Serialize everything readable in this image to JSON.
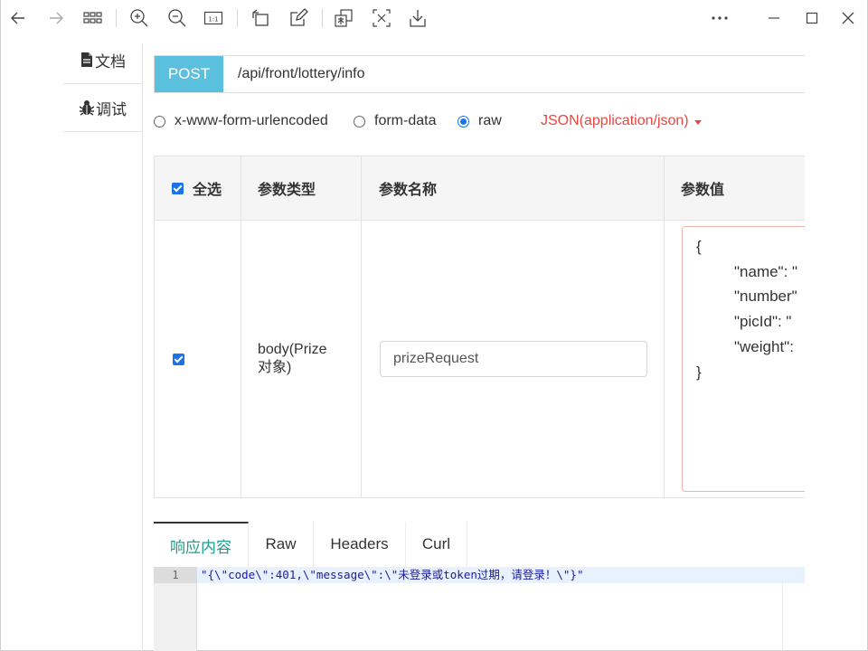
{
  "toolbar": {
    "buttons": [
      {
        "icon": "back-arrow-icon"
      },
      {
        "icon": "forward-arrow-icon"
      },
      {
        "icon": "grid-icon"
      },
      {
        "icon": "zoom-in-icon"
      },
      {
        "icon": "zoom-out-icon"
      },
      {
        "icon": "actual-size-icon"
      },
      {
        "icon": "rotate-icon"
      },
      {
        "icon": "edit-icon"
      },
      {
        "icon": "translate-icon"
      },
      {
        "icon": "ocr-icon"
      },
      {
        "icon": "download-icon"
      },
      {
        "icon": "more-icon"
      },
      {
        "icon": "minimize-icon"
      },
      {
        "icon": "maximize-icon"
      },
      {
        "icon": "close-icon"
      }
    ]
  },
  "nav": {
    "doc_label": "文档",
    "debug_label": "调试"
  },
  "request": {
    "method": "POST",
    "url": "/api/front/lottery/info"
  },
  "body_types": {
    "options": [
      "x-www-form-urlencoded",
      "form-data",
      "raw"
    ],
    "selected": "raw",
    "content_type": "JSON(application/json)"
  },
  "params_table": {
    "headers": {
      "select_all": "全选",
      "param_type": "参数类型",
      "param_name": "参数名称",
      "param_value": "参数值"
    },
    "rows": [
      {
        "checked": true,
        "type_line1": "body(Prize",
        "type_line2": "对象)",
        "name": "prizeRequest",
        "value_lines": [
          "{",
          "\"name\": \"",
          "\"number\"",
          "\"picId\": \"",
          "\"weight\":",
          "}"
        ]
      }
    ]
  },
  "response": {
    "tabs": [
      "响应内容",
      "Raw",
      "Headers",
      "Curl"
    ],
    "active_tab": "响应内容",
    "line_number": "1",
    "content": "\"{\\\"code\\\":401,\\\"message\\\":\\\"未登录或token过期，请登录！\\\"}\""
  },
  "colors": {
    "method_bg": "#5bc0de",
    "content_type": "#e8473f",
    "active_tab": "#1a9f8c",
    "accent": "#1a73e8"
  }
}
